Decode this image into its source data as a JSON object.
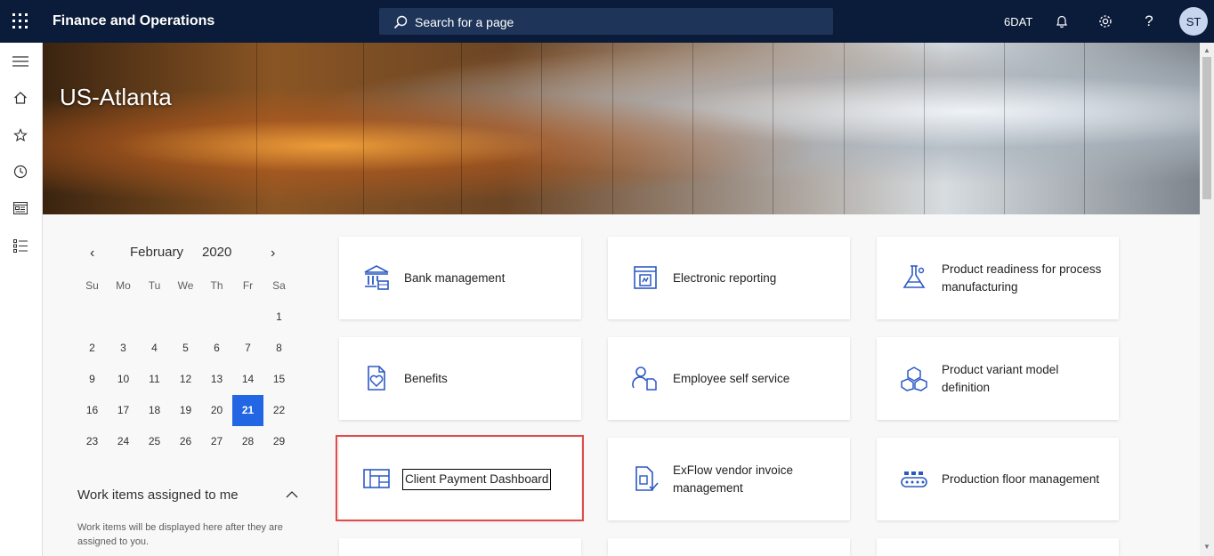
{
  "topbar": {
    "app_title": "Finance and Operations",
    "search_placeholder": "Search for a page",
    "company": "6DAT",
    "user_initials": "ST",
    "icons": [
      "app-launcher-icon",
      "search-icon",
      "bell-icon",
      "gear-icon",
      "help-icon"
    ]
  },
  "nav": {
    "items": [
      "hamburger-icon",
      "home-icon",
      "star-icon",
      "clock-icon",
      "workspace-icon",
      "modules-list-icon"
    ]
  },
  "banner": {
    "title": "US-Atlanta"
  },
  "calendar": {
    "month": "February",
    "year": "2020",
    "prev": "‹",
    "next": "›",
    "weekdays": [
      "Su",
      "Mo",
      "Tu",
      "We",
      "Th",
      "Fr",
      "Sa"
    ],
    "weeks": [
      [
        "",
        "",
        "",
        "",
        "",
        "",
        "1"
      ],
      [
        "2",
        "3",
        "4",
        "5",
        "6",
        "7",
        "8"
      ],
      [
        "9",
        "10",
        "11",
        "12",
        "13",
        "14",
        "15"
      ],
      [
        "16",
        "17",
        "18",
        "19",
        "20",
        "21",
        "22"
      ],
      [
        "23",
        "24",
        "25",
        "26",
        "27",
        "28",
        "29"
      ]
    ],
    "selected": "21"
  },
  "work_items": {
    "title": "Work items assigned to me",
    "text": "Work items will be displayed here after they are assigned to you."
  },
  "tiles": [
    {
      "label": "Bank management",
      "icon": "bank-icon"
    },
    {
      "label": "Electronic reporting",
      "icon": "report-icon"
    },
    {
      "label": "Product readiness for process manufacturing",
      "icon": "flask-icon"
    },
    {
      "label": "Benefits",
      "icon": "benefits-icon"
    },
    {
      "label": "Employee self service",
      "icon": "employee-icon"
    },
    {
      "label": "Product variant model definition",
      "icon": "cubes-icon"
    },
    {
      "label": "Client Payment Dashboard",
      "icon": "dashboard-icon"
    },
    {
      "label": "ExFlow vendor invoice management",
      "icon": "invoice-icon"
    },
    {
      "label": "Production floor management",
      "icon": "conveyor-icon"
    }
  ],
  "colors": {
    "topbar": "#0b1b3a",
    "accent": "#2266e3",
    "highlight": "#e14b4b"
  }
}
